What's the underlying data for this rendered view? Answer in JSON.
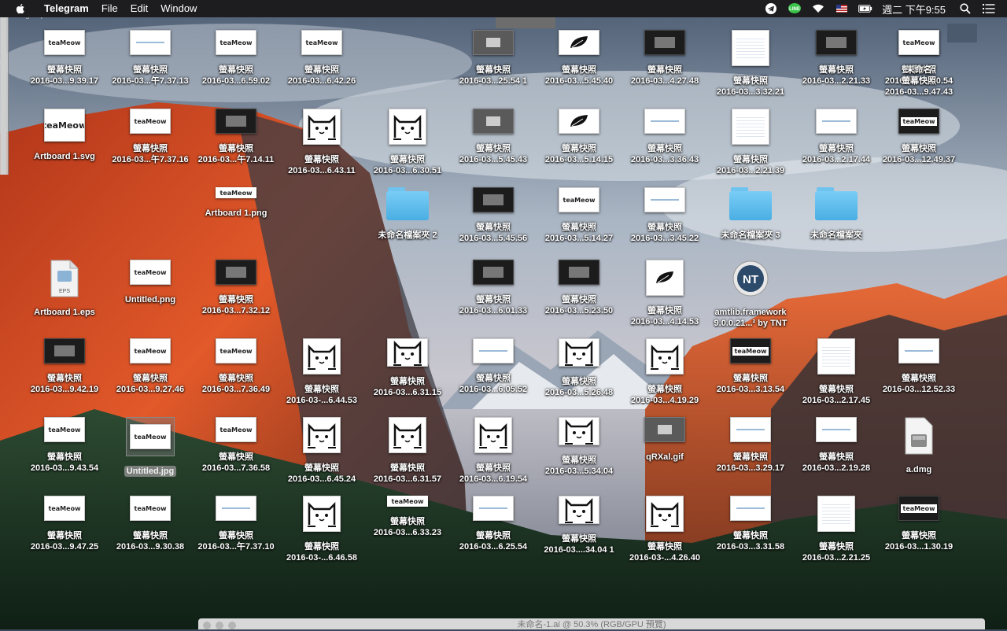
{
  "menubar": {
    "app_name": "Telegram",
    "menus": [
      "File",
      "Edit",
      "Window"
    ],
    "clock": "週二 下午9:55",
    "status_icons": [
      "telegram-icon",
      "line-icon",
      "wifi-icon",
      "flag-icon",
      "battery-icon",
      "search-icon",
      "list-icon"
    ]
  },
  "drag_hint": "Drag to pan view.",
  "bottom_window_title": "未命名-1.ai @ 50.3% (RGB/GPU 預覽)",
  "desktop_icons": [
    {
      "name": "螢幕快照",
      "sub": "2016-03...9.39.17",
      "kind": "logo-wide"
    },
    {
      "name": "螢幕快照",
      "sub": "2016-03...午7.37.13",
      "kind": "blank-wide"
    },
    {
      "name": "螢幕快照",
      "sub": "2016-03...6.59.02",
      "kind": "logo-wide"
    },
    {
      "name": "螢幕快照",
      "sub": "2016-03...6.42.26",
      "kind": "logo-wide"
    },
    {
      "name": "螢幕快照",
      "sub": "2016-03...25.54 1",
      "kind": "gray-wide"
    },
    {
      "name": "螢幕快照",
      "sub": "2016-03...5.45.40",
      "kind": "leaf-wide"
    },
    {
      "name": "螢幕快照",
      "sub": "2016-03...4.27.48",
      "kind": "dark-wide"
    },
    {
      "name": "螢幕快照",
      "sub": "2016-03...3.32.21",
      "kind": "blank-square"
    },
    {
      "name": "螢幕快照",
      "sub": "2016-03...2.21.33",
      "kind": "dark-wide"
    },
    {
      "name": "螢幕快照",
      "sub": "2016-03...1.50.54",
      "kind": "dark-wide"
    },
    {
      "name": "未命名",
      "sub": "螢幕快照",
      "sub2": "2016-03...9.47.43",
      "kind": "logo-wide"
    },
    {
      "name": "Artboard 1.svg",
      "sub": "",
      "kind": "logo-svg"
    },
    {
      "name": "螢幕快照",
      "sub": "2016-03...午7.37.16",
      "kind": "logo-wide"
    },
    {
      "name": "螢幕快照",
      "sub": "2016-03...午7.14.11",
      "kind": "dark-wide"
    },
    {
      "name": "螢幕快照",
      "sub": "2016-03...6.43.11",
      "kind": "cat"
    },
    {
      "name": "螢幕快照",
      "sub": "2016-03...6.30.51",
      "kind": "cat"
    },
    {
      "name": "螢幕快照",
      "sub": "2016-03...5.45.43",
      "kind": "gray-wide"
    },
    {
      "name": "螢幕快照",
      "sub": "2016-03...5.14.15",
      "kind": "leaf-wide"
    },
    {
      "name": "螢幕快照",
      "sub": "2016-03...3.36.43",
      "kind": "blank-wide"
    },
    {
      "name": "螢幕快照",
      "sub": "2016-03...2.21.39",
      "kind": "blank-square"
    },
    {
      "name": "螢幕快照",
      "sub": "2016-03...2.17.44",
      "kind": "blank-wide"
    },
    {
      "name": "螢幕快照",
      "sub": "2016-03...12.49.37",
      "kind": "logo-dark"
    },
    {
      "name": "Artboard 1.png",
      "sub": "",
      "kind": "logo-bare"
    },
    {
      "name": "未命名檔案夾 2",
      "sub": "",
      "kind": "folder"
    },
    {
      "name": "螢幕快照",
      "sub": "2016-03...5.45.56",
      "kind": "dark-wide"
    },
    {
      "name": "螢幕快照",
      "sub": "2016-03...5.14.27",
      "kind": "logo-wide"
    },
    {
      "name": "螢幕快照",
      "sub": "2016-03...3.45.22",
      "kind": "blank-wide"
    },
    {
      "name": "未命名檔案夾 3",
      "sub": "",
      "kind": "folder"
    },
    {
      "name": "未命名檔案夾",
      "sub": "",
      "kind": "folder"
    },
    {
      "name": "Artboard 1.eps",
      "sub": "",
      "kind": "eps"
    },
    {
      "name": "Untitled.png",
      "sub": "",
      "kind": "logo-wide"
    },
    {
      "name": "螢幕快照",
      "sub": "2016-03...7.32.12",
      "kind": "dark-wide"
    },
    {
      "name": "螢幕快照",
      "sub": "2016-03...6.01.33",
      "kind": "dark-wide"
    },
    {
      "name": "螢幕快照",
      "sub": "2016-03...5.23.50",
      "kind": "dark-wide"
    },
    {
      "name": "螢幕快照",
      "sub": "2016-03...4.14.53",
      "kind": "leaf-square"
    },
    {
      "name": "amtlib.framework",
      "sub": "9.0.0.21...² by TNT",
      "kind": "tnt"
    },
    {
      "name": "螢幕快照",
      "sub": "2016-03...9.42.19",
      "kind": "dark-wide"
    },
    {
      "name": "螢幕快照",
      "sub": "2016-03...9.27.46",
      "kind": "logo-wide"
    },
    {
      "name": "螢幕快照",
      "sub": "2016-03...7.36.49",
      "kind": "logo-wide"
    },
    {
      "name": "螢幕快照",
      "sub": "2016-03-...6.44.53",
      "kind": "cat"
    },
    {
      "name": "螢幕快照",
      "sub": "2016-03...6.31.15",
      "kind": "cat-wide"
    },
    {
      "name": "螢幕快照",
      "sub": "2016-03...6.05.52",
      "kind": "blank-wide"
    },
    {
      "name": "螢幕快照",
      "sub": "2016-03...5.26.48",
      "kind": "cat-wide"
    },
    {
      "name": "螢幕快照",
      "sub": "2016-03...4.19.29",
      "kind": "cat"
    },
    {
      "name": "螢幕快照",
      "sub": "2016-03...3.13.54",
      "kind": "logo-dark"
    },
    {
      "name": "螢幕快照",
      "sub": "2016-03...2.17.45",
      "kind": "blank-square"
    },
    {
      "name": "螢幕快照",
      "sub": "2016-03...12.52.33",
      "kind": "blank-wide"
    },
    {
      "name": "螢幕快照",
      "sub": "2016-03...9.43.54",
      "kind": "logo-wide"
    },
    {
      "name": "Untitled.jpg",
      "sub": "",
      "kind": "logo-selected"
    },
    {
      "name": "螢幕快照",
      "sub": "2016-03...7.36.58",
      "kind": "logo-wide"
    },
    {
      "name": "螢幕快照",
      "sub": "2016-03...6.45.24",
      "kind": "cat"
    },
    {
      "name": "螢幕快照",
      "sub": "2016-03...6.31.57",
      "kind": "cat"
    },
    {
      "name": "螢幕快照",
      "sub": "2016-03...6.19.54",
      "kind": "cat"
    },
    {
      "name": "螢幕快照",
      "sub": "2016-03...5.34.04",
      "kind": "cat-wide"
    },
    {
      "name": "qRXal.gif",
      "sub": "",
      "kind": "gray-wide"
    },
    {
      "name": "螢幕快照",
      "sub": "2016-03...3.29.17",
      "kind": "blank-wide"
    },
    {
      "name": "螢幕快照",
      "sub": "2016-03...2.19.28",
      "kind": "blank-wide"
    },
    {
      "name": "a.dmg",
      "sub": "",
      "kind": "dmg"
    },
    {
      "name": "螢幕快照",
      "sub": "2016-03...9.47.25",
      "kind": "logo-wide"
    },
    {
      "name": "螢幕快照",
      "sub": "2016-03...9.30.38",
      "kind": "logo-wide"
    },
    {
      "name": "螢幕快照",
      "sub": "2016-03...午7.37.10",
      "kind": "blank-wide"
    },
    {
      "name": "螢幕快照",
      "sub": "2016-03-...6.46.58",
      "kind": "cat"
    },
    {
      "name": "螢幕快照",
      "sub": "2016-03...6.33.23",
      "kind": "logo-bare"
    },
    {
      "name": "螢幕快照",
      "sub": "2016-03...6.25.54",
      "kind": "blank-wide"
    },
    {
      "name": "螢幕快照",
      "sub": "2016-03....34.04 1",
      "kind": "cat-wide"
    },
    {
      "name": "螢幕快照",
      "sub": "2016-03-...4.26.40",
      "kind": "cat"
    },
    {
      "name": "螢幕快照",
      "sub": "2016-03...3.31.58",
      "kind": "blank-wide"
    },
    {
      "name": "螢幕快照",
      "sub": "2016-03...2.21.25",
      "kind": "blank-square"
    },
    {
      "name": "螢幕快照",
      "sub": "2016-03...1.30.19",
      "kind": "logo-dark"
    }
  ],
  "logo_text": "teaMeow",
  "eps_text": "EPS",
  "tnt_text": "NT"
}
